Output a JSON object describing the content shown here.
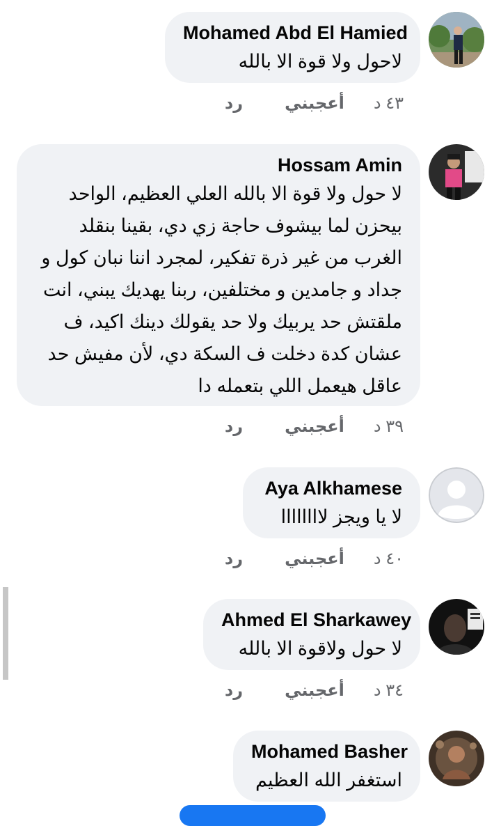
{
  "comments": [
    {
      "name": "Mohamed Abd El Hamied",
      "text": "لاحول ولا قوة الا بالله",
      "time": "٤٣ د",
      "like": "أعجبني",
      "reply": "رد"
    },
    {
      "name": "Hossam Amin",
      "text": "لا حول ولا قوة الا بالله العلي العظيم، الواحد بيحزن لما بيشوف حاجة زي دي، بقينا بنقلد الغرب من غير ذرة تفكير، لمجرد اننا نبان كول و جداد و جامدين و مختلفين، ربنا يهديك يبني، انت ملقتش حد يربيك ولا حد يقولك دينك اكيد، ف عشان كدة دخلت ف السكة دي، لأن مفيش حد عاقل هيعمل اللي بتعمله دا",
      "time": "٣٩ د",
      "like": "أعجبني",
      "reply": "رد"
    },
    {
      "name": "Aya Alkhamese",
      "text": "لا يا ويجز لاااااااا",
      "time": "٤٠ د",
      "like": "أعجبني",
      "reply": "رد"
    },
    {
      "name": "Ahmed El Sharkawey",
      "text": "لا حول ولاقوة الا بالله",
      "time": "٣٤ د",
      "like": "أعجبني",
      "reply": "رد"
    },
    {
      "name": "Mohamed Basher",
      "text": "استغفر الله العظيم",
      "time": "",
      "like": "",
      "reply": ""
    }
  ]
}
